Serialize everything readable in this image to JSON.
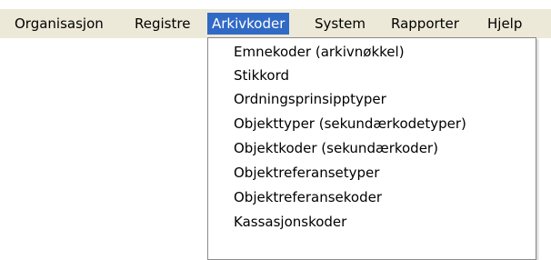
{
  "menubar": {
    "items": [
      {
        "label": "Organisasjon"
      },
      {
        "label": "Registre"
      },
      {
        "label": "Arkivkoder"
      },
      {
        "label": "System"
      },
      {
        "label": "Rapporter"
      },
      {
        "label": "Hjelp"
      }
    ],
    "active_item": "Arkivkoder"
  },
  "dropdown": {
    "items": [
      {
        "label": "Emnekoder (arkivnøkkel)"
      },
      {
        "label": "Stikkord"
      },
      {
        "label": "Ordningsprinsipptyper"
      },
      {
        "label": "Objekttyper (sekundærkodetyper)"
      },
      {
        "label": "Objektkoder (sekundærkoder)"
      },
      {
        "label": "Objektreferansetyper"
      },
      {
        "label": "Objektreferansekoder"
      },
      {
        "label": "Kassasjonskoder"
      }
    ]
  },
  "colors": {
    "menubar_background": "#ece9d8",
    "highlight": "#316ac5",
    "dropdown_border": "#8a8a8a"
  }
}
